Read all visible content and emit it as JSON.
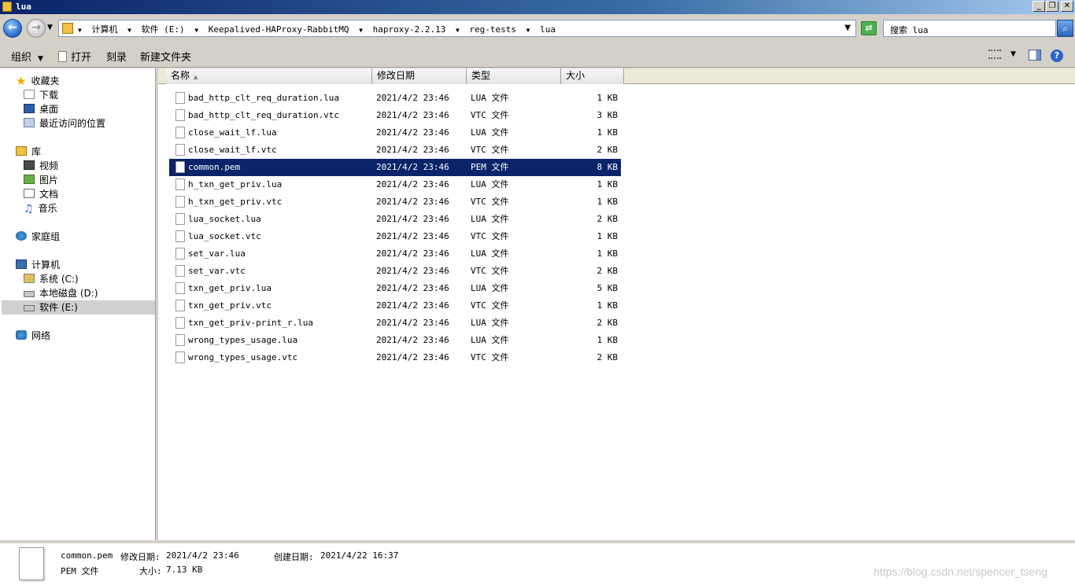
{
  "window": {
    "title": "lua"
  },
  "address": {
    "crumbs": [
      "计算机",
      "软件 (E:)",
      "Keepalived-HAProxy-RabbitMQ",
      "haproxy-2.2.13",
      "reg-tests",
      "lua"
    ],
    "search_placeholder": "搜索 lua"
  },
  "toolbar": {
    "organize_label": "组织",
    "open_label": "打开",
    "burn_label": "刻录",
    "new_folder_label": "新建文件夹"
  },
  "sidebar": {
    "favorites": {
      "label": "收藏夹",
      "items": [
        {
          "label": "下载"
        },
        {
          "label": "桌面"
        },
        {
          "label": "最近访问的位置"
        }
      ]
    },
    "libraries": {
      "label": "库",
      "items": [
        {
          "label": "视频"
        },
        {
          "label": "图片"
        },
        {
          "label": "文档"
        },
        {
          "label": "音乐"
        }
      ]
    },
    "homegroup": {
      "label": "家庭组"
    },
    "computer": {
      "label": "计算机",
      "items": [
        {
          "label": "系统 (C:)"
        },
        {
          "label": "本地磁盘 (D:)"
        },
        {
          "label": "软件 (E:)"
        }
      ]
    },
    "network": {
      "label": "网络"
    }
  },
  "columns": {
    "name": "名称",
    "date": "修改日期",
    "type": "类型",
    "size": "大小"
  },
  "files": [
    {
      "name": "bad_http_clt_req_duration.lua",
      "date": "2021/4/2 23:46",
      "type": "LUA 文件",
      "size": "1 KB"
    },
    {
      "name": "bad_http_clt_req_duration.vtc",
      "date": "2021/4/2 23:46",
      "type": "VTC 文件",
      "size": "3 KB"
    },
    {
      "name": "close_wait_lf.lua",
      "date": "2021/4/2 23:46",
      "type": "LUA 文件",
      "size": "1 KB"
    },
    {
      "name": "close_wait_lf.vtc",
      "date": "2021/4/2 23:46",
      "type": "VTC 文件",
      "size": "2 KB"
    },
    {
      "name": "common.pem",
      "date": "2021/4/2 23:46",
      "type": "PEM 文件",
      "size": "8 KB"
    },
    {
      "name": "h_txn_get_priv.lua",
      "date": "2021/4/2 23:46",
      "type": "LUA 文件",
      "size": "1 KB"
    },
    {
      "name": "h_txn_get_priv.vtc",
      "date": "2021/4/2 23:46",
      "type": "VTC 文件",
      "size": "1 KB"
    },
    {
      "name": "lua_socket.lua",
      "date": "2021/4/2 23:46",
      "type": "LUA 文件",
      "size": "2 KB"
    },
    {
      "name": "lua_socket.vtc",
      "date": "2021/4/2 23:46",
      "type": "VTC 文件",
      "size": "1 KB"
    },
    {
      "name": "set_var.lua",
      "date": "2021/4/2 23:46",
      "type": "LUA 文件",
      "size": "1 KB"
    },
    {
      "name": "set_var.vtc",
      "date": "2021/4/2 23:46",
      "type": "VTC 文件",
      "size": "2 KB"
    },
    {
      "name": "txn_get_priv.lua",
      "date": "2021/4/2 23:46",
      "type": "LUA 文件",
      "size": "5 KB"
    },
    {
      "name": "txn_get_priv.vtc",
      "date": "2021/4/2 23:46",
      "type": "VTC 文件",
      "size": "1 KB"
    },
    {
      "name": "txn_get_priv-print_r.lua",
      "date": "2021/4/2 23:46",
      "type": "LUA 文件",
      "size": "2 KB"
    },
    {
      "name": "wrong_types_usage.lua",
      "date": "2021/4/2 23:46",
      "type": "LUA 文件",
      "size": "1 KB"
    },
    {
      "name": "wrong_types_usage.vtc",
      "date": "2021/4/2 23:46",
      "type": "VTC 文件",
      "size": "2 KB"
    }
  ],
  "details": {
    "filename": "common.pem",
    "modified_label": "修改日期:",
    "modified_value": "2021/4/2 23:46",
    "created_label": "创建日期:",
    "created_value": "2021/4/22 16:37",
    "type": "PEM 文件",
    "size_label": "大小:",
    "size_value": "7.13 KB"
  },
  "watermark": "https://blog.csdn.net/spencer_tseng"
}
